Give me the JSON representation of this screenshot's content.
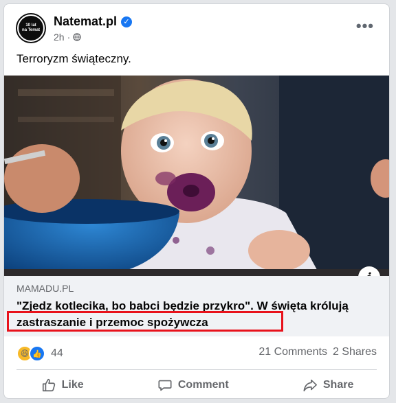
{
  "page": {
    "name": "Natemat.pl",
    "time": "2h",
    "avatar_text_top": "10 lat",
    "avatar_text_bottom": "na Temat"
  },
  "post": {
    "text": "Terroryzm świąteczny."
  },
  "link": {
    "domain": "MAMADU.PL",
    "headline": "\"Zjedz kotlecika, bo babci będzie przykro\". W święta królują zastraszanie i przemoc spożywcza"
  },
  "stats": {
    "reaction_count": "44",
    "comments": "21 Comments",
    "shares": "2 Shares"
  },
  "actions": {
    "like": "Like",
    "comment": "Comment",
    "share": "Share"
  },
  "icons": [
    "verified-icon",
    "globe-icon",
    "more-icon",
    "info-icon",
    "haha-icon",
    "like-reaction-icon",
    "like-icon",
    "comment-icon",
    "share-icon"
  ],
  "colors": {
    "accent": "#1877f2",
    "highlight": "#e8121b",
    "secondary_text": "#65676b"
  }
}
